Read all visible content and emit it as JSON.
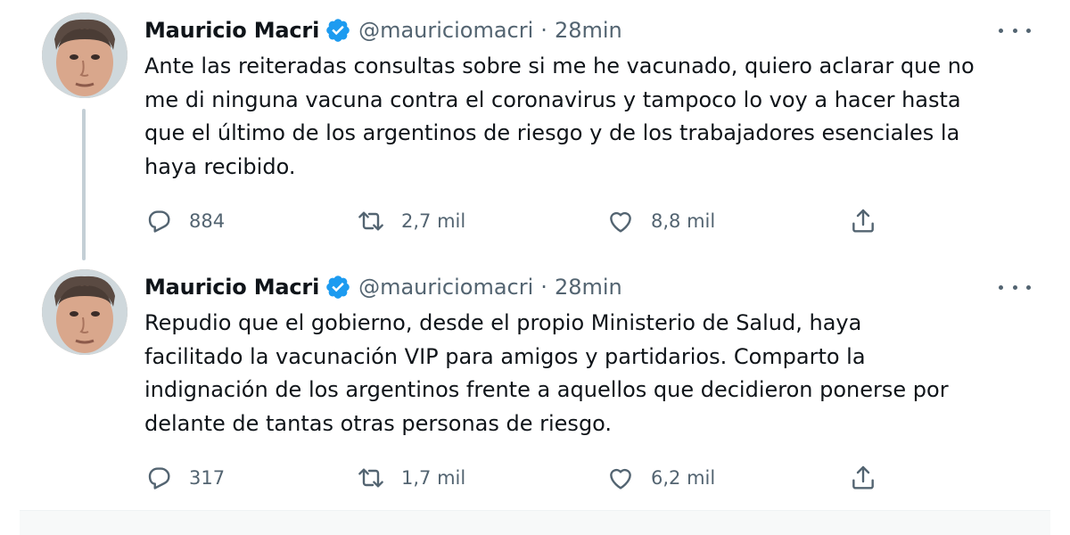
{
  "tweets": [
    {
      "author": {
        "name": "Mauricio Macri",
        "handle": "@mauriciomacri",
        "verified": true
      },
      "separator": "·",
      "time": "28min",
      "text_lines": [
        "Ante las reiteradas consultas sobre si me he vacunado, quiero aclarar que no",
        "me di ninguna vacuna contra el coronavirus y tampoco lo voy a hacer hasta",
        "que el último de los argentinos de riesgo y de los trabajadores esenciales la",
        "haya recibido."
      ],
      "actions": {
        "replies": "884",
        "retweets": "2,7 mil",
        "likes": "8,8 mil"
      }
    },
    {
      "author": {
        "name": "Mauricio Macri",
        "handle": "@mauriciomacri",
        "verified": true
      },
      "separator": "·",
      "time": "28min",
      "text_lines": [
        "Repudio que el gobierno, desde el propio Ministerio de Salud, haya",
        "facilitado la vacunación VIP para amigos y partidarios. Comparto la",
        "indignación de los argentinos frente a aquellos que decidieron ponerse por",
        "delante de tantas otras personas de riesgo."
      ],
      "actions": {
        "replies": "317",
        "retweets": "1,7 mil",
        "likes": "6,2 mil"
      }
    }
  ],
  "colors": {
    "verified": "#1d9bf0",
    "secondary_text": "#536471",
    "primary_text": "#0f1419",
    "thread_line": "#c4cfd6"
  },
  "icons": [
    "verified-badge-icon",
    "more-options-icon",
    "reply-icon",
    "retweet-icon",
    "like-icon",
    "share-icon"
  ]
}
